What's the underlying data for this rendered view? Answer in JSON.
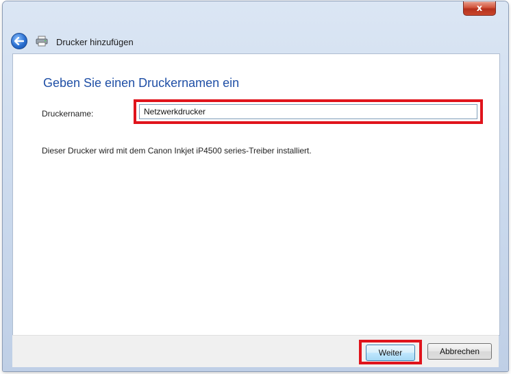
{
  "window": {
    "close_label": "x",
    "title": "Drucker hinzufügen"
  },
  "icons": {
    "back": "back-arrow-icon",
    "printer": "printer-icon"
  },
  "main": {
    "heading": "Geben Sie einen Druckernamen ein",
    "name_label": "Druckername:",
    "name_value": "Netzwerkdrucker",
    "info_text": "Dieser Drucker wird mit dem Canon Inkjet iP4500 series-Treiber installiert."
  },
  "footer": {
    "next_label": "Weiter",
    "cancel_label": "Abbrechen"
  },
  "colors": {
    "heading": "#1f4fa6",
    "highlight": "#e0141c",
    "close": "#c9462d"
  }
}
